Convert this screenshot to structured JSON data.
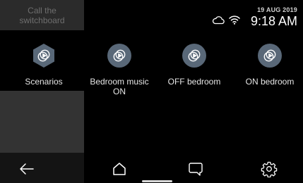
{
  "sidebar": {
    "switchboard_line1": "Call the",
    "switchboard_line2": "switchboard"
  },
  "status": {
    "date": "19 AUG 2019",
    "time": "9:18 AM",
    "icons": [
      "cloud-icon",
      "wifi-icon"
    ]
  },
  "scenarios": [
    {
      "label": "Scenarios",
      "icon": "play-scenario-icon"
    },
    {
      "label": "Bedroom music ON",
      "icon": "play-scenario-icon"
    },
    {
      "label": "OFF bedroom",
      "icon": "play-scenario-icon"
    },
    {
      "label": "ON bedroom",
      "icon": "play-scenario-icon"
    }
  ],
  "nav": {
    "icons": [
      "back-arrow-icon",
      "home-icon",
      "chat-icon",
      "settings-icon"
    ]
  },
  "colors": {
    "icon_fill": "#596878",
    "icon_glyph": "#ffffff",
    "sidebar_top": "#2b2b2b",
    "sidebar_lower": "#333333"
  }
}
